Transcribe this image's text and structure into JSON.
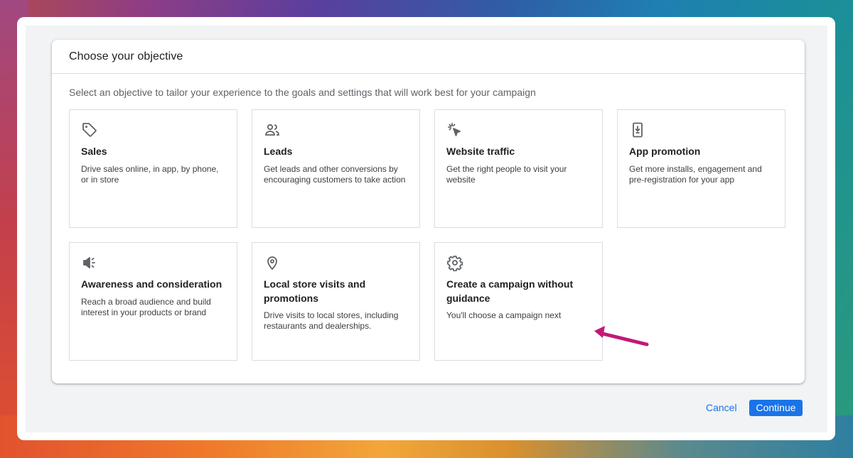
{
  "dialog": {
    "title": "Choose your objective",
    "subtitle": "Select an objective to tailor your experience to the goals and settings that will work best for your campaign"
  },
  "objectives": [
    {
      "icon": "tag-icon",
      "title": "Sales",
      "description": "Drive sales online, in app, by phone, or in store"
    },
    {
      "icon": "people-icon",
      "title": "Leads",
      "description": "Get leads and other conversions by encouraging customers to take action"
    },
    {
      "icon": "cursor-click-icon",
      "title": "Website traffic",
      "description": "Get the right people to visit your website"
    },
    {
      "icon": "phone-download-icon",
      "title": "App promotion",
      "description": "Get more installs, engagement and pre-registration for your app"
    },
    {
      "icon": "megaphone-icon",
      "title": "Awareness and consideration",
      "description": "Reach a broad audience and build interest in your products or brand"
    },
    {
      "icon": "location-pin-icon",
      "title": "Local store visits and promotions",
      "description": "Drive visits to local stores, including restaurants and dealerships."
    },
    {
      "icon": "gear-icon",
      "title": "Create a campaign without guidance",
      "description": "You'll choose a campaign next"
    }
  ],
  "footer": {
    "cancel_label": "Cancel",
    "continue_label": "Continue"
  },
  "colors": {
    "accent": "#1a73e8",
    "annotation_arrow": "#c2187a"
  }
}
